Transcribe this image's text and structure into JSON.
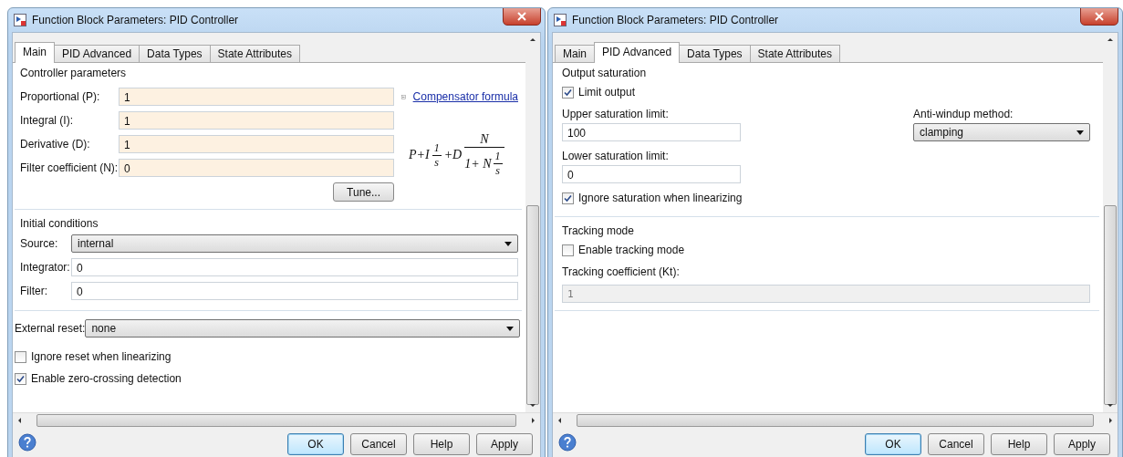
{
  "windows": [
    {
      "title": "Function Block Parameters: PID Controller",
      "kind": "main",
      "tabs": [
        {
          "label": "Main",
          "selected": true
        },
        {
          "label": "PID Advanced",
          "selected": false
        },
        {
          "label": "Data Types",
          "selected": false
        },
        {
          "label": "State Attributes",
          "selected": false
        }
      ],
      "controller": {
        "legend": "Controller parameters",
        "fields": [
          {
            "label": "Proportional (P):",
            "value": "1"
          },
          {
            "label": "Integral (I):",
            "value": "1"
          },
          {
            "label": "Derivative (D):",
            "value": "1"
          },
          {
            "label": "Filter coefficient (N):",
            "value": "0"
          }
        ],
        "formula_link": {
          "label": "Compensator formula",
          "expanded": true
        },
        "formula": {
          "lead": "P+I",
          "num1": "1",
          "den1": "s",
          "mid": "+D",
          "num2": "N",
          "den2": "1+ N",
          "num3": "1",
          "den3": "s"
        },
        "tune_button": "Tune..."
      },
      "initial": {
        "legend": "Initial conditions",
        "source": {
          "label": "Source:",
          "value": "internal"
        },
        "fields": [
          {
            "label": "Integrator:",
            "value": "0"
          },
          {
            "label": "Filter:",
            "value": "0"
          }
        ]
      },
      "external_reset": {
        "label": "External reset:",
        "value": "none"
      },
      "checkboxes": [
        {
          "label": "Ignore reset when linearizing",
          "checked": false
        },
        {
          "label": "Enable zero-crossing detection",
          "checked": true
        }
      ],
      "buttons": [
        {
          "label": "OK",
          "default": true
        },
        {
          "label": "Cancel",
          "default": false
        },
        {
          "label": "Help",
          "default": false
        },
        {
          "label": "Apply",
          "default": false
        }
      ]
    },
    {
      "title": "Function Block Parameters: PID Controller",
      "kind": "advanced",
      "tabs": [
        {
          "label": "Main",
          "selected": false
        },
        {
          "label": "PID Advanced",
          "selected": true
        },
        {
          "label": "Data Types",
          "selected": false
        },
        {
          "label": "State Attributes",
          "selected": false
        }
      ],
      "output_saturation": {
        "legend": "Output saturation",
        "limit_output": {
          "label": "Limit output",
          "checked": true
        },
        "upper": {
          "label": "Upper saturation limit:",
          "value": "100"
        },
        "anti_windup": {
          "label": "Anti-windup method:",
          "value": "clamping"
        },
        "lower": {
          "label": "Lower saturation limit:",
          "value": "0"
        },
        "ignore": {
          "label": "Ignore saturation when linearizing",
          "checked": true
        }
      },
      "tracking": {
        "legend": "Tracking mode",
        "enable": {
          "label": "Enable tracking mode",
          "checked": false
        },
        "coefficient": {
          "label": "Tracking coefficient (Kt):",
          "value": "1",
          "disabled": true
        }
      },
      "buttons": [
        {
          "label": "OK",
          "default": true
        },
        {
          "label": "Cancel",
          "default": false
        },
        {
          "label": "Help",
          "default": false
        },
        {
          "label": "Apply",
          "default": false
        }
      ]
    }
  ]
}
